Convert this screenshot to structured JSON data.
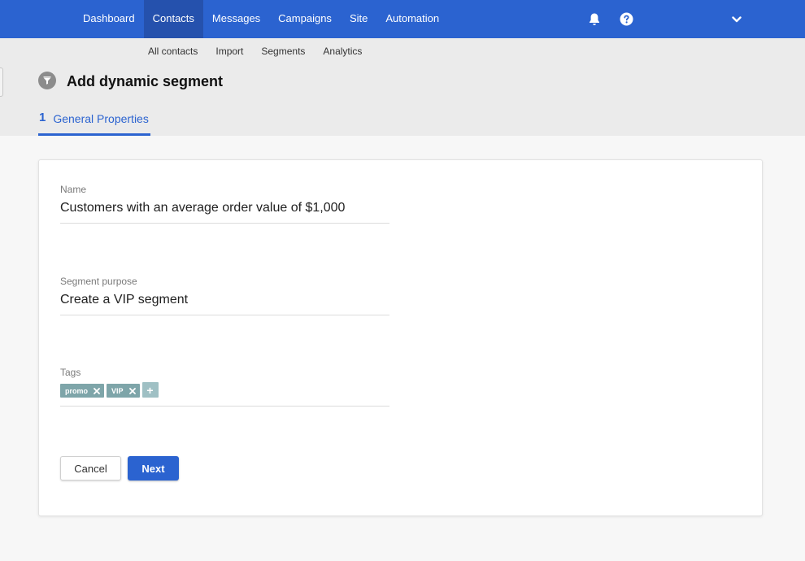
{
  "nav": {
    "items": [
      {
        "label": "Dashboard"
      },
      {
        "label": "Contacts"
      },
      {
        "label": "Messages"
      },
      {
        "label": "Campaigns"
      },
      {
        "label": "Site"
      },
      {
        "label": "Automation"
      }
    ],
    "active": "Contacts",
    "icons": [
      "bell-icon",
      "help-icon",
      "chevron-down-icon"
    ]
  },
  "subnav": {
    "items": [
      {
        "label": "All contacts"
      },
      {
        "label": "Import"
      },
      {
        "label": "Segments"
      },
      {
        "label": "Analytics"
      }
    ]
  },
  "page": {
    "title": "Add dynamic segment",
    "title_icon": "filter-icon"
  },
  "steps": [
    {
      "number": "1",
      "label": "General Properties"
    }
  ],
  "form": {
    "name": {
      "label": "Name",
      "value": "Customers with an average order value of $1,000"
    },
    "purpose": {
      "label": "Segment purpose",
      "value": "Create a VIP segment"
    },
    "tags": {
      "label": "Tags",
      "items": [
        {
          "label": "promo"
        },
        {
          "label": "VIP"
        }
      ],
      "add_label": "+"
    }
  },
  "buttons": {
    "cancel": "Cancel",
    "next": "Next"
  },
  "colors": {
    "primary": "#2b63d0",
    "tag": "#7ea5a9",
    "tag_add": "#9fc0c4"
  }
}
